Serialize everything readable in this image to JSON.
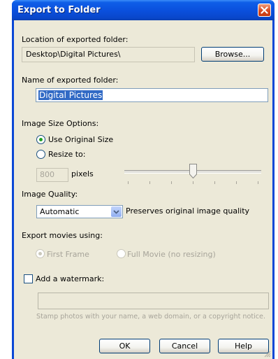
{
  "window": {
    "title": "Export to Folder"
  },
  "location": {
    "label": "Location of exported folder:",
    "path": "Desktop\\Digital Pictures\\",
    "browse_label": "Browse..."
  },
  "name": {
    "label": "Name of exported folder:",
    "value": "Digital Pictures"
  },
  "size_options": {
    "label": "Image Size Options:",
    "use_original_label": "Use Original Size",
    "use_original_selected": true,
    "resize_label": "Resize to:",
    "resize_selected": false,
    "pixel_value": "800",
    "pixels_label": "pixels",
    "slider_fraction": 0.5
  },
  "quality": {
    "label": "Image Quality:",
    "selected": "Automatic",
    "description": "Preserves original image quality"
  },
  "movies": {
    "label": "Export movies using:",
    "first_frame_label": "First Frame",
    "first_frame_selected": true,
    "full_movie_label": "Full Movie (no resizing)"
  },
  "watermark": {
    "label": "Add a watermark:",
    "checked": false,
    "text_value": "",
    "hint": "Stamp photos with your name, a web domain, or a copyright notice."
  },
  "buttons": {
    "ok": "OK",
    "cancel": "Cancel",
    "help": "Help"
  },
  "colors": {
    "titlebar": "#0a4fdc",
    "dialog_background": "#ece9d8",
    "selection": "#316ac5",
    "close_button": "#d9481e"
  }
}
